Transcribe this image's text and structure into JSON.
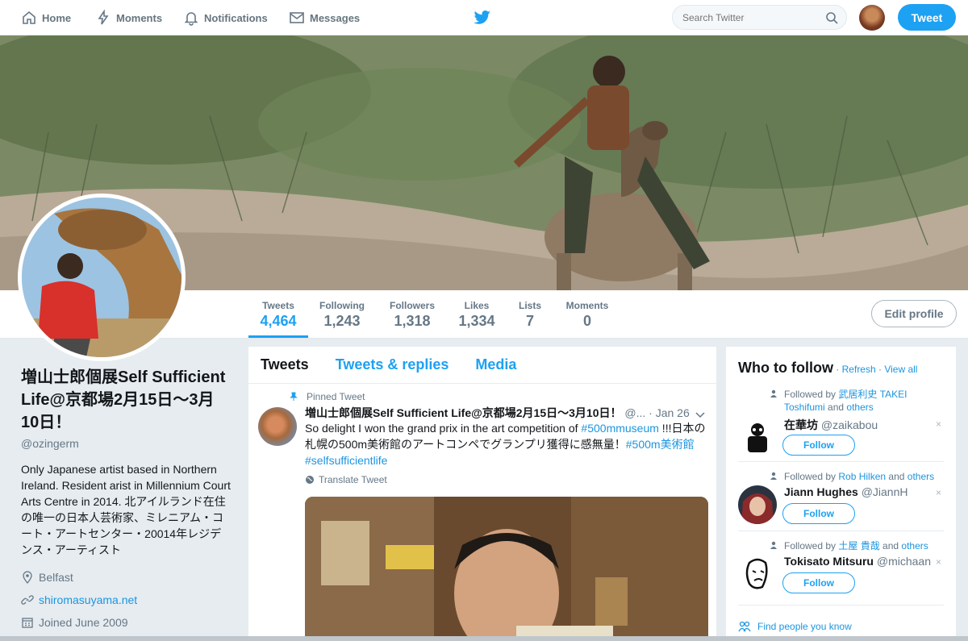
{
  "nav": {
    "home": "Home",
    "moments": "Moments",
    "notifications": "Notifications",
    "messages": "Messages",
    "search_placeholder": "Search Twitter",
    "tweet_button": "Tweet"
  },
  "profile_nav": {
    "stats": [
      {
        "label": "Tweets",
        "value": "4,464"
      },
      {
        "label": "Following",
        "value": "1,243"
      },
      {
        "label": "Followers",
        "value": "1,318"
      },
      {
        "label": "Likes",
        "value": "1,334"
      },
      {
        "label": "Lists",
        "value": "7"
      },
      {
        "label": "Moments",
        "value": "0"
      }
    ],
    "edit_profile": "Edit profile"
  },
  "profile": {
    "name": "増山士郎個展Self Sufficient Life@京都場2月15日〜3月10日！",
    "handle": "@ozingerm",
    "bio": "Only Japanese artist based in Northern Ireland. Resident arist in Millennium Court Arts Centre in 2014. 北アイルランド在住の唯一の日本人芸術家、ミレニアム・コート・アートセンター・20014年レジデンス・アーティスト",
    "location": "Belfast",
    "website": "shiromasuyama.net",
    "joined": "Joined June 2009"
  },
  "timeline": {
    "tabs": [
      "Tweets",
      "Tweets & replies",
      "Media"
    ],
    "pinned_label": "Pinned Tweet",
    "tweet": {
      "name": "増山士郎個展Self Sufficient Life@京都場2月15日〜3月10日！",
      "handle_short": "@...",
      "date": "· Jan 26",
      "text_1": "So delight I won the grand prix in the art competition of ",
      "hashtag_1": "#500mmuseum",
      "text_2": " !!!日本の札幌の500m美術館のアートコンペでグランプリ獲得に感無量！",
      "hashtag_2": "#500m美術館",
      "hashtag_3": "#selfsufficientlife",
      "translate": "Translate Tweet"
    }
  },
  "who_to_follow": {
    "title": "Who to follow",
    "sep": " · ",
    "refresh": "Refresh",
    "view_all": "View all",
    "suggestions": [
      {
        "ctx_prefix": "Followed by ",
        "ctx_names": "武居利史 TAKEI Toshifumi",
        "ctx_suffix": " and ",
        "ctx_others": "others",
        "name": "在華坊",
        "handle": "@zaikabou",
        "follow": "Follow"
      },
      {
        "ctx_prefix": "Followed by ",
        "ctx_names": "Rob Hilken",
        "ctx_suffix": " and ",
        "ctx_others": "others",
        "name": "Jiann Hughes",
        "handle": "@JiannH",
        "follow": "Follow"
      },
      {
        "ctx_prefix": "Followed by ",
        "ctx_names": "土屋 貴哉",
        "ctx_suffix": " and ",
        "ctx_others": "others",
        "name": "Tokisato Mitsuru",
        "handle": "@michaan",
        "follow": "Follow"
      }
    ],
    "dismiss": "×",
    "find_people": "Find people you know"
  },
  "colors": {
    "accent": "#1da1f2",
    "link": "#1b95e0",
    "muted": "#657786"
  },
  "icons": [
    "home-icon",
    "lightning-icon",
    "bell-icon",
    "envelope-icon",
    "twitter-bird-icon",
    "search-icon",
    "pin-icon",
    "globe-icon",
    "location-icon",
    "link-icon",
    "calendar-icon",
    "user-icon",
    "people-icon",
    "chevron-down-icon"
  ]
}
